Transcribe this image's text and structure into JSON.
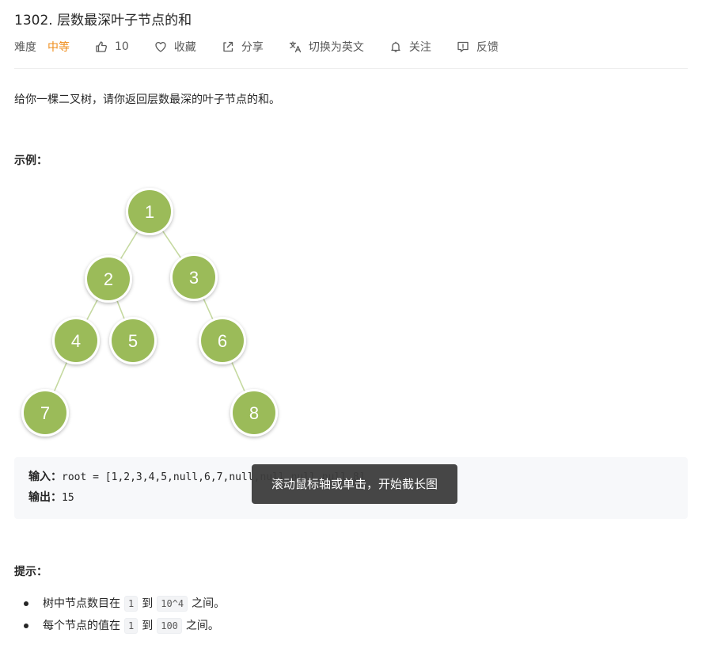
{
  "problem": {
    "title": "1302. 层数最深叶子节点的和",
    "difficulty_label": "难度",
    "difficulty_value": "中等",
    "likes": "10",
    "favorite_label": "收藏",
    "share_label": "分享",
    "translate_label": "切换为英文",
    "follow_label": "关注",
    "feedback_label": "反馈",
    "description": "给你一棵二叉树，请你返回层数最深的叶子节点的和。"
  },
  "example": {
    "heading": "示例：",
    "input_label": "输入：",
    "input_value": "root = [1,2,3,4,5,null,6,7,null,null,null,null,8]",
    "output_label": "输出：",
    "output_value": "15",
    "tree_nodes": [
      "1",
      "2",
      "3",
      "4",
      "5",
      "6",
      "7",
      "8"
    ]
  },
  "tooltip": "滚动鼠标轴或单击，开始截长图",
  "hints": {
    "heading": "提示：",
    "items": [
      {
        "pre": "树中节点数目在",
        "a": "1",
        "mid": "到",
        "b": "10^4",
        "post": "之间。"
      },
      {
        "pre": "每个节点的值在",
        "a": "1",
        "mid": "到",
        "b": "100",
        "post": "之间。"
      }
    ]
  },
  "colors": {
    "difficulty": "#ef8c1a",
    "node_fill": "#9bbb59",
    "edge": "#c5d9a0",
    "tooltip_bg": "#3c3c3c"
  },
  "icons": [
    "thumbs-up-icon",
    "heart-icon",
    "share-icon",
    "translate-icon",
    "bell-icon",
    "feedback-icon"
  ]
}
